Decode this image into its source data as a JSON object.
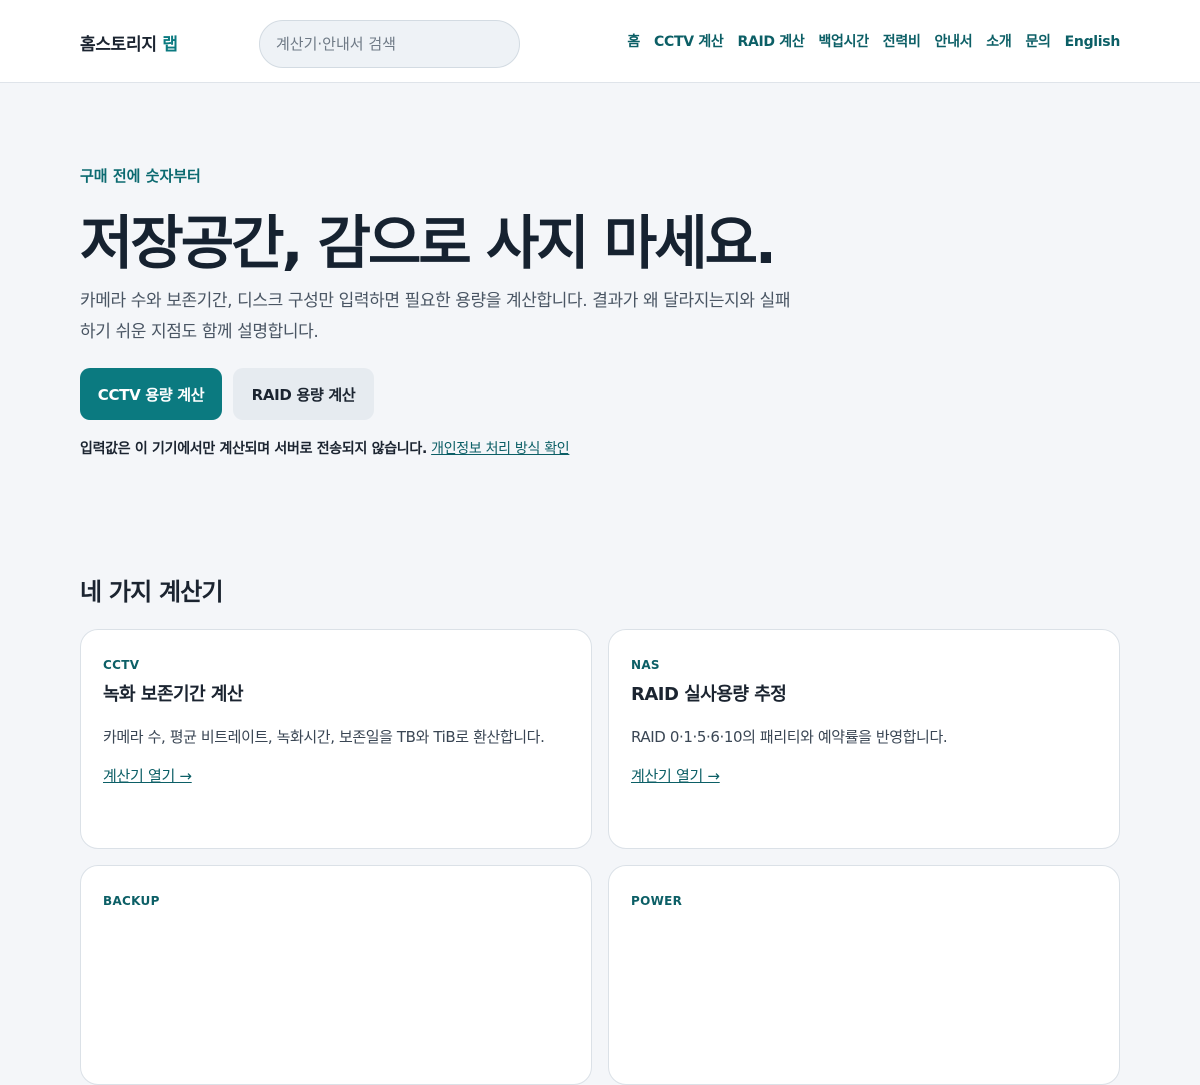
{
  "header": {
    "logo_main": "홈스토리지",
    "logo_accent": "랩",
    "search_placeholder": "계산기·안내서 검색",
    "nav": [
      {
        "label": "홈"
      },
      {
        "label": "CCTV 계산"
      },
      {
        "label": "RAID 계산"
      },
      {
        "label": "백업시간"
      },
      {
        "label": "전력비"
      },
      {
        "label": "안내서"
      },
      {
        "label": "소개"
      },
      {
        "label": "문의"
      },
      {
        "label": "English"
      }
    ]
  },
  "hero": {
    "eyebrow": "구매 전에 숫자부터",
    "title": "저장공간, 감으로 사지 마세요.",
    "description": "카메라 수와 보존기간, 디스크 구성만 입력하면 필요한 용량을 계산합니다. 결과가 왜 달라지는지와 실패하기 쉬운 지점도 함께 설명합니다.",
    "primary_button": "CCTV 용량 계산",
    "secondary_button": "RAID 용량 계산",
    "privacy_text": "입력값은 이 기기에서만 계산되며 서버로 전송되지 않습니다.",
    "privacy_link": "개인정보 처리 방식 확인"
  },
  "calculators": {
    "section_title": "네 가지 계산기",
    "cards": [
      {
        "tag": "CCTV",
        "title": "녹화 보존기간 계산",
        "description": "카메라 수, 평균 비트레이트, 녹화시간, 보존일을 TB와 TiB로 환산합니다.",
        "link": "계산기 열기 →"
      },
      {
        "tag": "NAS",
        "title": "RAID 실사용량 추정",
        "description": "RAID 0·1·5·6·10의 패리티와 예약률을 반영합니다.",
        "link": "계산기 열기 →"
      },
      {
        "tag": "BACKUP",
        "title": "",
        "description": "",
        "link": ""
      },
      {
        "tag": "POWER",
        "title": "",
        "description": "",
        "link": ""
      }
    ]
  },
  "colors": {
    "accent": "#0b7a80",
    "nav_text": "#0c5f66",
    "page_bg": "#f4f6f9",
    "header_bg": "#ffffff"
  }
}
